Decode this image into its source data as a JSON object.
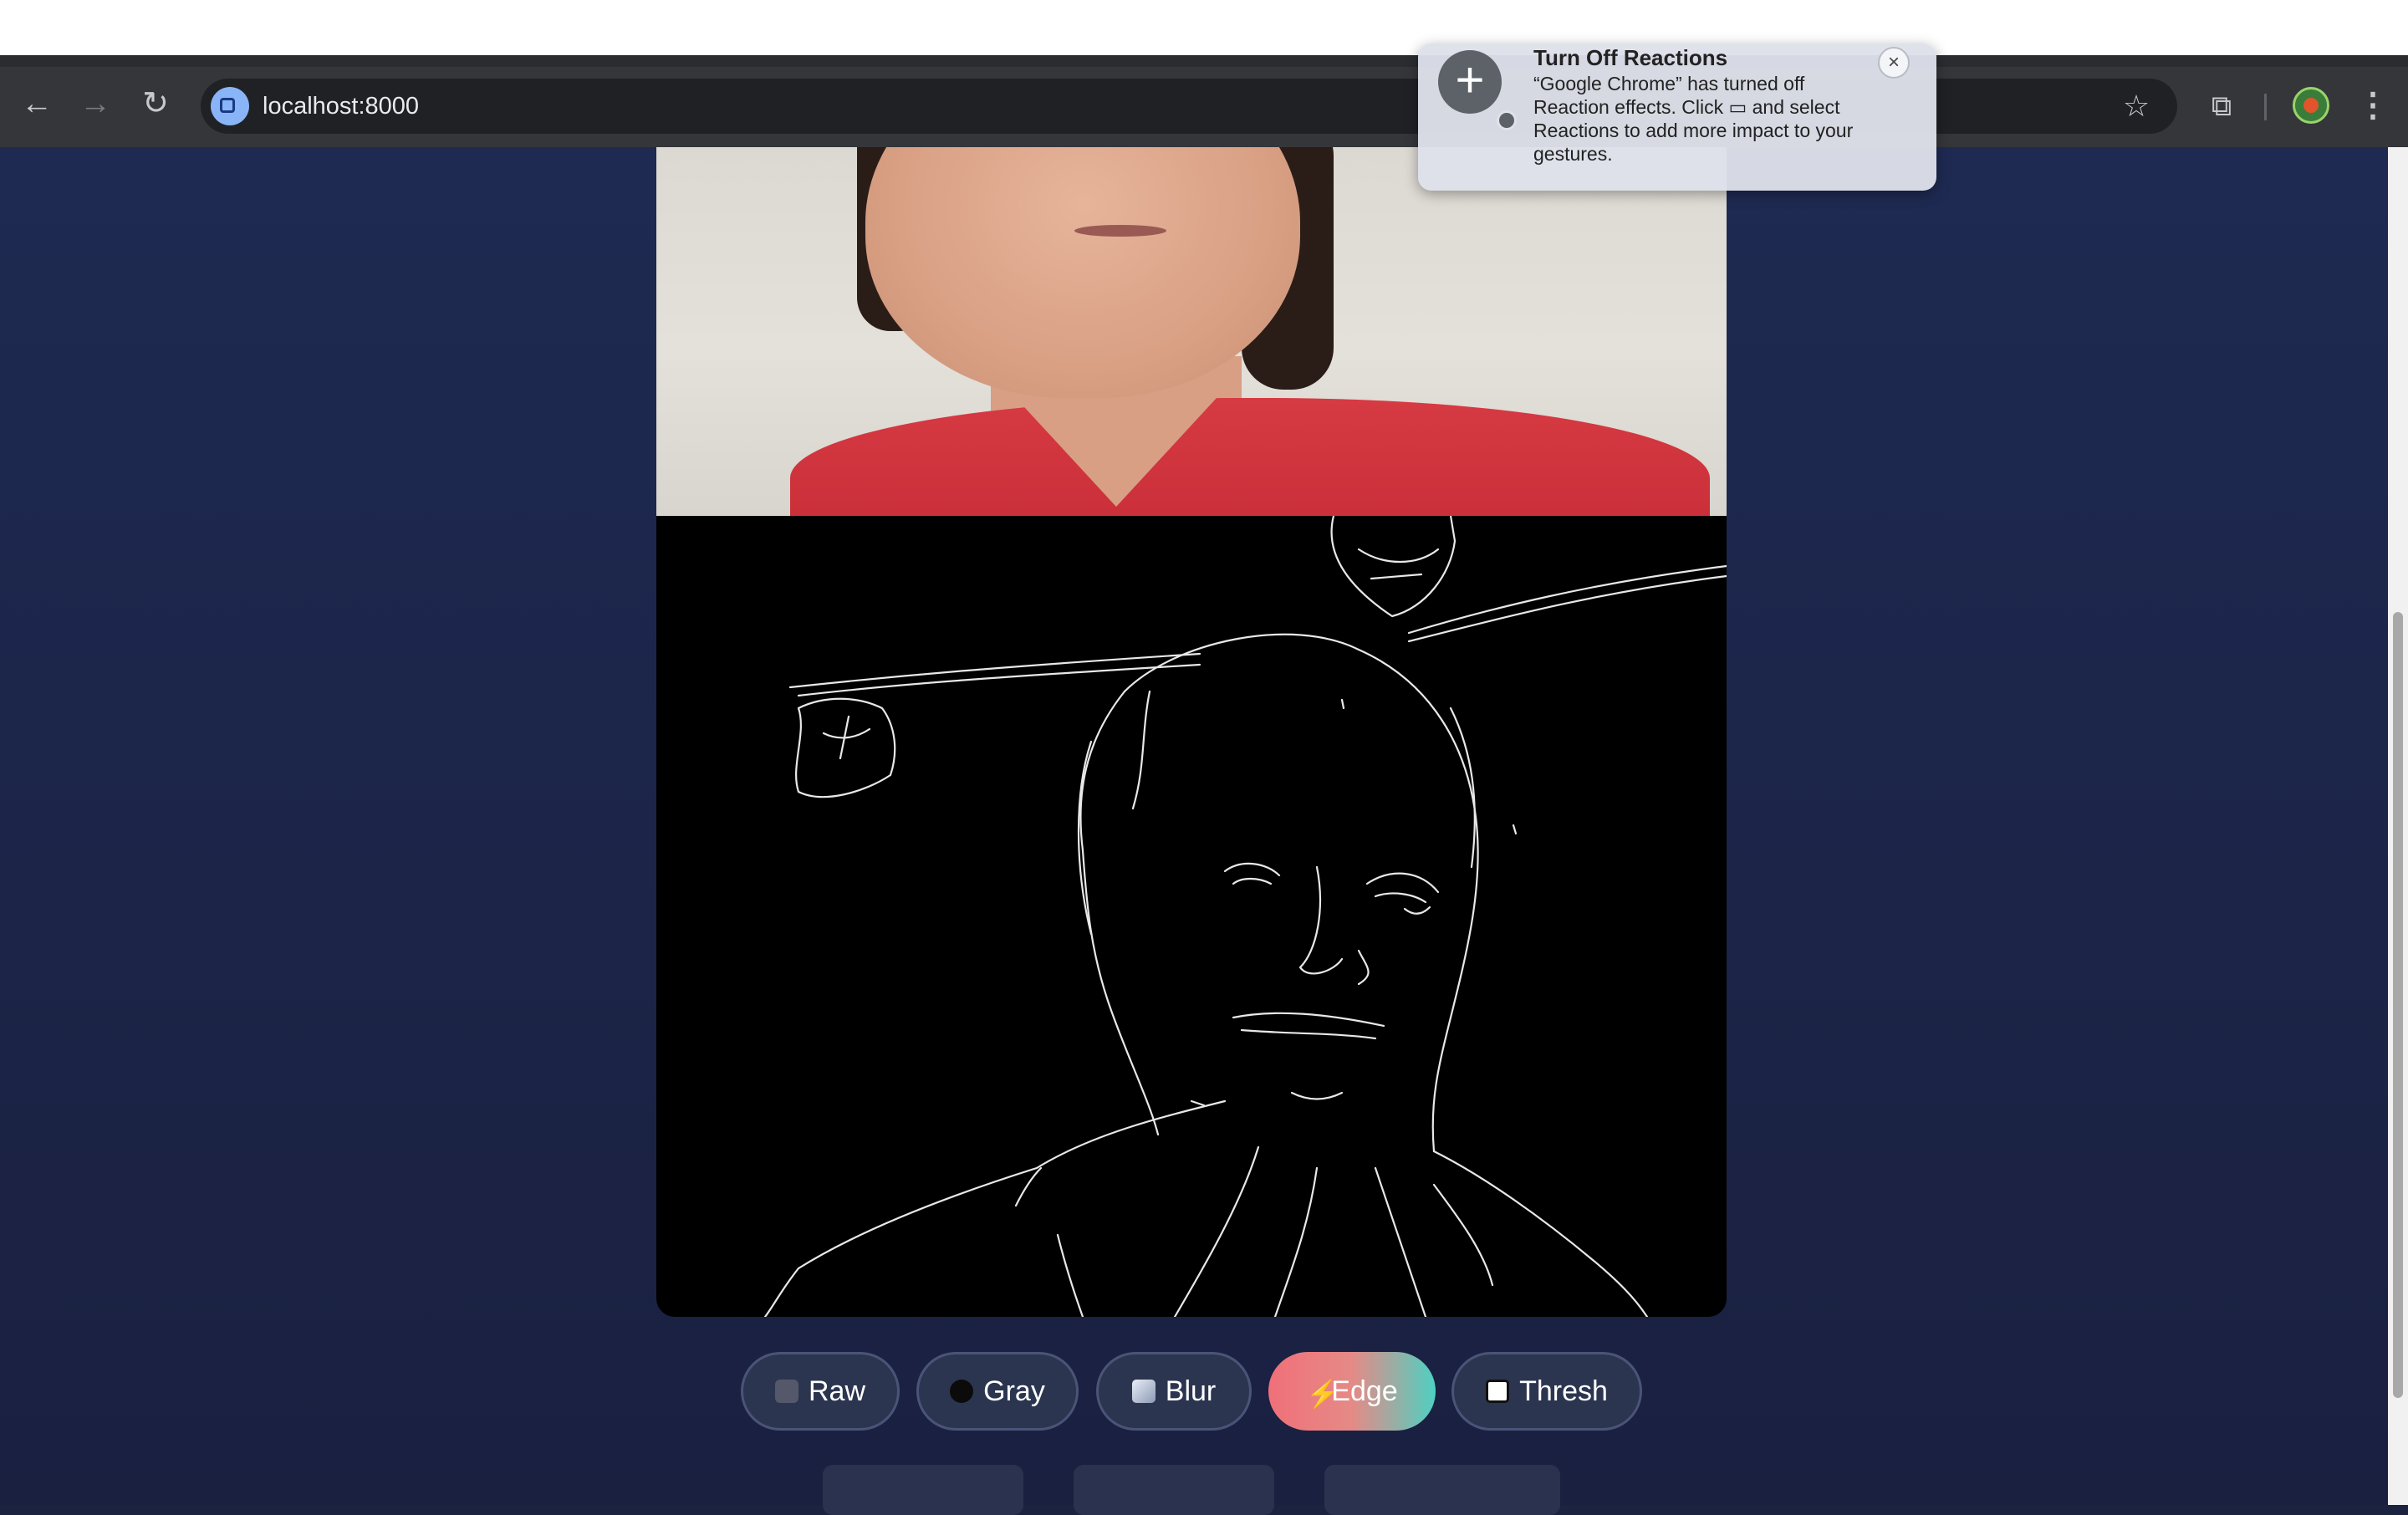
{
  "browser": {
    "url": "localhost:8000",
    "back_icon": "←",
    "forward_icon": "→",
    "reload_icon": "↻",
    "star_icon": "☆",
    "extensions_icon": "⧉",
    "menu_icon": "⋮"
  },
  "notification": {
    "title": "Turn Off Reactions",
    "body": "“Google Chrome” has turned off Reaction effects. Click ▭ and select Reactions to add more impact to your gestures.",
    "close_icon": "×",
    "plus_icon": "+"
  },
  "filters": {
    "active": "Edge",
    "items": [
      {
        "label": "Raw"
      },
      {
        "label": "Gray"
      },
      {
        "label": "Blur"
      },
      {
        "label": "Edge"
      },
      {
        "label": "Thresh"
      }
    ],
    "edge_icon": "⚡"
  },
  "colors": {
    "page_background": "#1b2340",
    "button_background": "#2c3550",
    "active_gradient_start": "#f07079",
    "active_gradient_end": "#4fd0c2"
  }
}
